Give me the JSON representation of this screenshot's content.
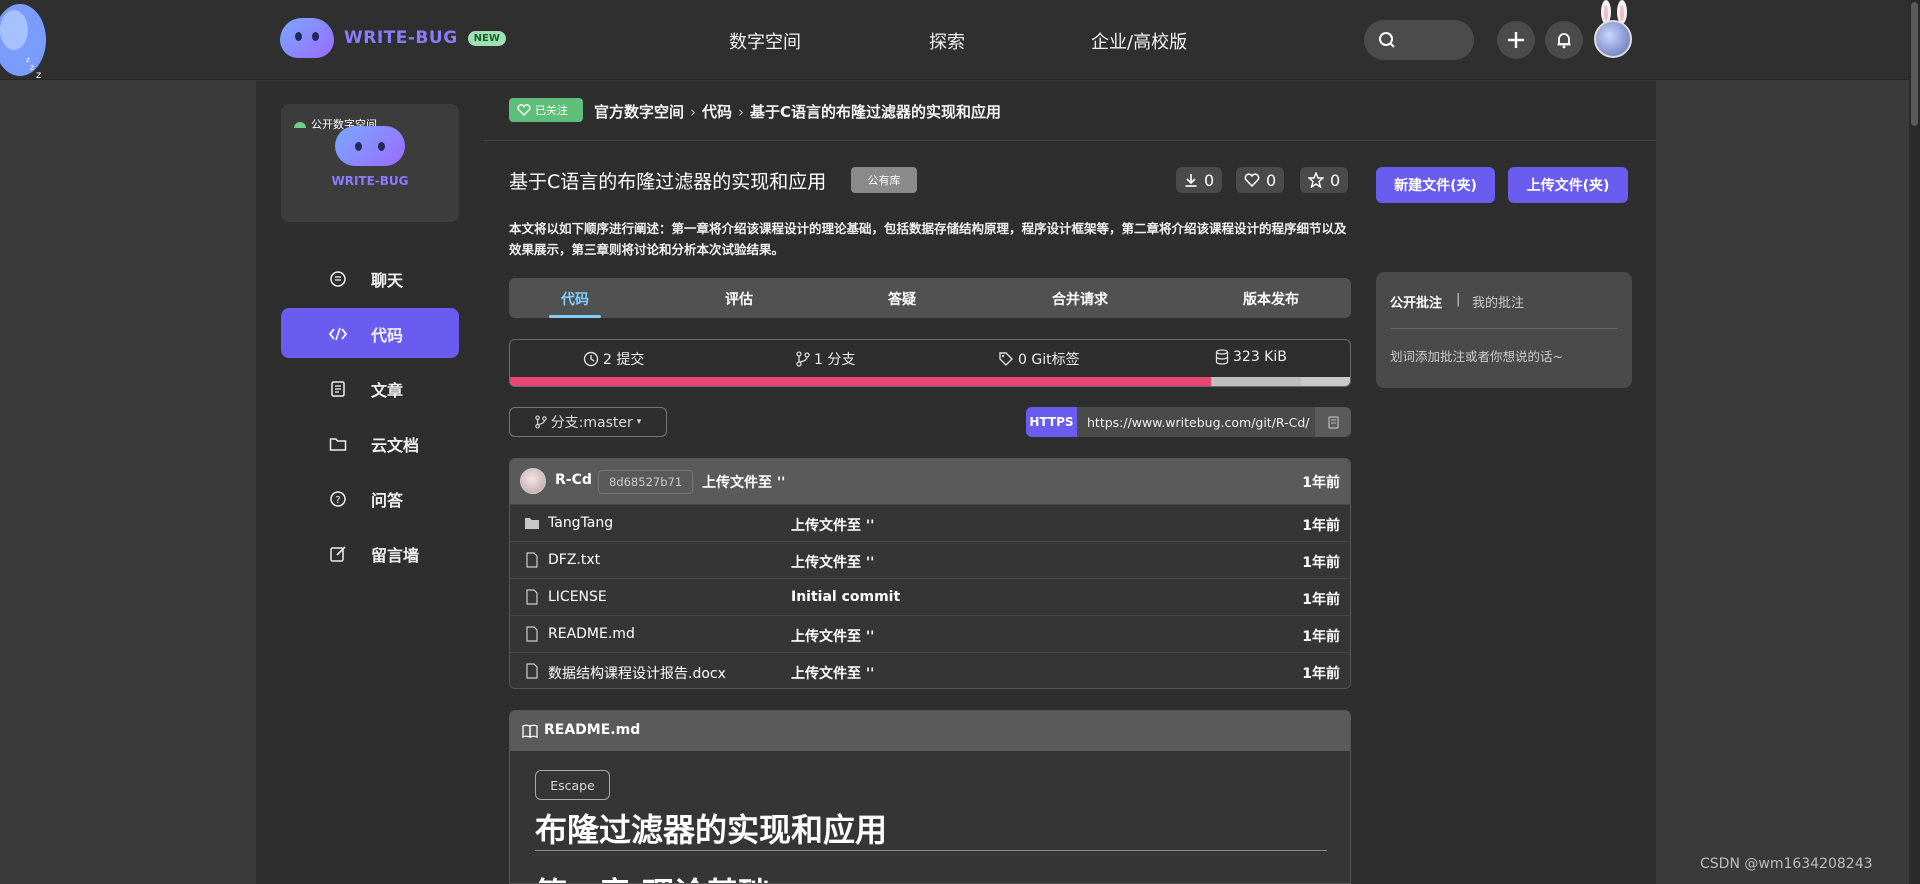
{
  "brand": {
    "name": "WRITE-BUG",
    "badge": "NEW"
  },
  "topnav": [
    "数字空间",
    "探索",
    "企业/高校版"
  ],
  "sidebar": {
    "space_tag": "公开数字空间",
    "space_name": "WRITE-BUG",
    "items": [
      {
        "label": "聊天",
        "icon": "chat-icon"
      },
      {
        "label": "代码",
        "icon": "code-icon",
        "active": true
      },
      {
        "label": "文章",
        "icon": "article-icon"
      },
      {
        "label": "云文档",
        "icon": "folder-icon"
      },
      {
        "label": "问答",
        "icon": "question-icon"
      },
      {
        "label": "留言墙",
        "icon": "edit-icon"
      }
    ]
  },
  "breadcrumb": {
    "follow_label": "已关注",
    "items": [
      "官方数字空间",
      "代码",
      "基于C语言的布隆过滤器的实现和应用"
    ]
  },
  "repo": {
    "title": "基于C语言的布隆过滤器的实现和应用",
    "badge": "公有库",
    "downloads": "0",
    "likes": "0",
    "stars": "0",
    "description": "本文将以如下顺序进行阐述：第一章将介绍该课程设计的理论基础，包括数据存储结构原理，程序设计框架等，第二章将介绍该课程设计的程序细节以及效果展示，第三章则将讨论和分析本次试验结果。"
  },
  "actions": {
    "new_file": "新建文件(夹)",
    "upload_file": "上传文件(夹)"
  },
  "tabs": [
    "代码",
    "评估",
    "答疑",
    "合并请求",
    "版本发布"
  ],
  "stats": {
    "commits": "2 提交",
    "branches": "1 分支",
    "tags": "0 Git标签",
    "size": "323 KiB",
    "lang_fraction_primary": 0.835,
    "lang_fraction_secondary": 0.107,
    "colors": {
      "primary": "#e6466f",
      "secondary": "#bdbdbd"
    }
  },
  "branch": {
    "label": "分支:master"
  },
  "clone": {
    "protocol": "HTTPS",
    "url": "https://www.writebug.com/git/R-Cd/"
  },
  "last_commit": {
    "author": "R-Cd",
    "hash": "8d68527b71",
    "message": "上传文件至 ''",
    "time": "1年前"
  },
  "files": [
    {
      "name": "TangTang",
      "type": "folder",
      "message": "上传文件至 ''",
      "time": "1年前"
    },
    {
      "name": "DFZ.txt",
      "type": "file",
      "message": "上传文件至 ''",
      "time": "1年前"
    },
    {
      "name": "LICENSE",
      "type": "file",
      "message": "Initial commit",
      "time": "1年前"
    },
    {
      "name": "README.md",
      "type": "file",
      "message": "上传文件至 ''",
      "time": "1年前"
    },
    {
      "name": "数据结构课程设计报告.docx",
      "type": "file",
      "message": "上传文件至 ''",
      "time": "1年前"
    }
  ],
  "readme": {
    "filename": "README.md",
    "chip": "Escape",
    "h1": "布隆过滤器的实现和应用",
    "h2": "第一章 理论基础"
  },
  "notes": {
    "tab_public": "公开批注",
    "separator": "|",
    "tab_mine": "我的批注",
    "hint": "划词添加批注或者你想说的话~"
  },
  "watermark": "CSDN @wm1634208243",
  "colors": {
    "accent": "#6b5cf0",
    "follow": "#5fbf7a",
    "active_tab": "#7fd0ff"
  }
}
